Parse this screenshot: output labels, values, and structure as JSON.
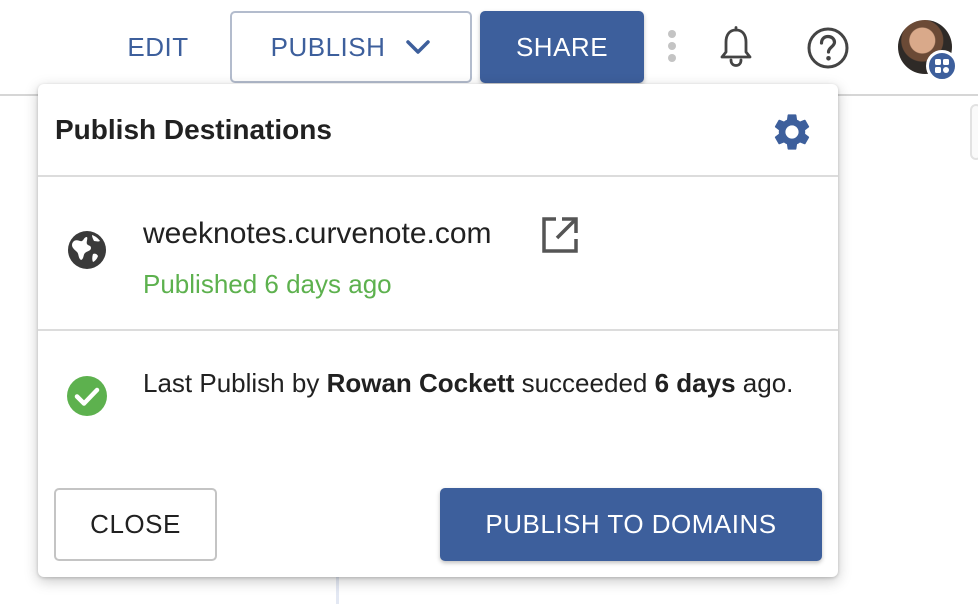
{
  "toolbar": {
    "edit_label": "EDIT",
    "publish_label": "PUBLISH",
    "share_label": "SHARE",
    "icons": [
      "more-vert-icon",
      "bell-icon",
      "help-icon",
      "avatar",
      "org-badge-icon"
    ]
  },
  "dialog": {
    "title": "Publish Destinations",
    "settings_icon": "gear-icon",
    "destination": {
      "icon": "globe-icon",
      "domain": "weeknotes.curvenote.com",
      "link_icon": "open-in-new-icon",
      "status": "Published 6 days ago"
    },
    "log": {
      "icon": "check-circle-icon",
      "prefix": "Last Publish by ",
      "user": "Rowan Cockett",
      "middle": " succeeded ",
      "when": "6 days",
      "suffix": " ago."
    },
    "close_label": "CLOSE",
    "publish_domains_label": "PUBLISH TO DOMAINS"
  },
  "colors": {
    "primary": "#3d5f9c",
    "success": "#5db14e",
    "text": "#212121",
    "icon": "#3d3d3d"
  }
}
